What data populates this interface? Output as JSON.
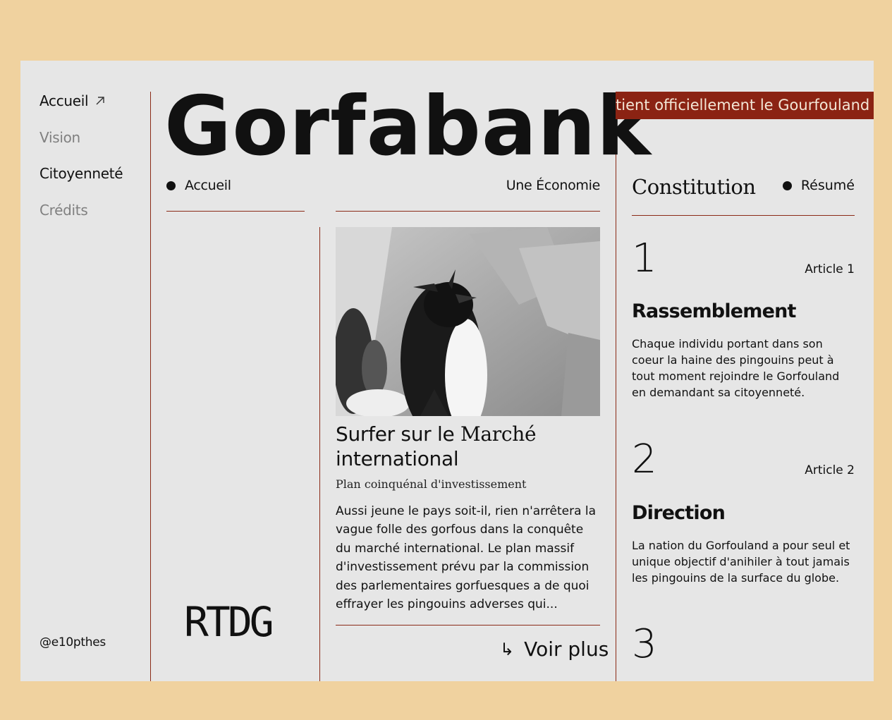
{
  "nav": {
    "items": [
      {
        "label": "Accueil",
        "active": true
      },
      {
        "label": "Vision",
        "active": false
      },
      {
        "label": "Citoyenneté",
        "active": true
      },
      {
        "label": "Crédits",
        "active": false
      }
    ],
    "arrow_icon": "arrow-up-right-icon"
  },
  "footer": {
    "handle": "@e10pthes"
  },
  "header": {
    "title": "Gorfabank",
    "left_label": "Accueil",
    "right_label": "Une Économie"
  },
  "article": {
    "title_part1": "Surfer sur le ",
    "title_part2": "Marché",
    "title_part3": "international",
    "subtitle": "Plan coinquénal d'investissement",
    "body": "Aussi jeune le pays soit-il, rien n'arrêtera la vague folle des gorfous dans la conquête du marché international. Le plan massif d'investissement prévu par la commission des parlementaires gorfuesques a de quoi effrayer les pingouins adverses qui...",
    "link_label": "Voir plus",
    "link_icon": "corner-arrow-icon"
  },
  "logo": {
    "text": "RTDG"
  },
  "ticker": {
    "text": "tient officiellement le Gourfouland"
  },
  "constitution": {
    "title": "Constitution",
    "summary_label": "Résumé",
    "articles": [
      {
        "number": "1",
        "label": "Article 1",
        "title": "Rassemblement",
        "body": "Chaque individu portant dans son coeur la haine des pingouins peut à tout moment rejoindre le Gorfouland en demandant sa citoyenneté."
      },
      {
        "number": "2",
        "label": "Article 2",
        "title": "Direction",
        "body": "La nation du Gorfouland a pour seul et unique objectif d'anihiler à tout jamais les pingouins de la surface du globe."
      },
      {
        "number": "3"
      }
    ]
  },
  "colors": {
    "accent": "#8b2313",
    "background": "#f0d29f",
    "panel": "#e6e6e6"
  }
}
